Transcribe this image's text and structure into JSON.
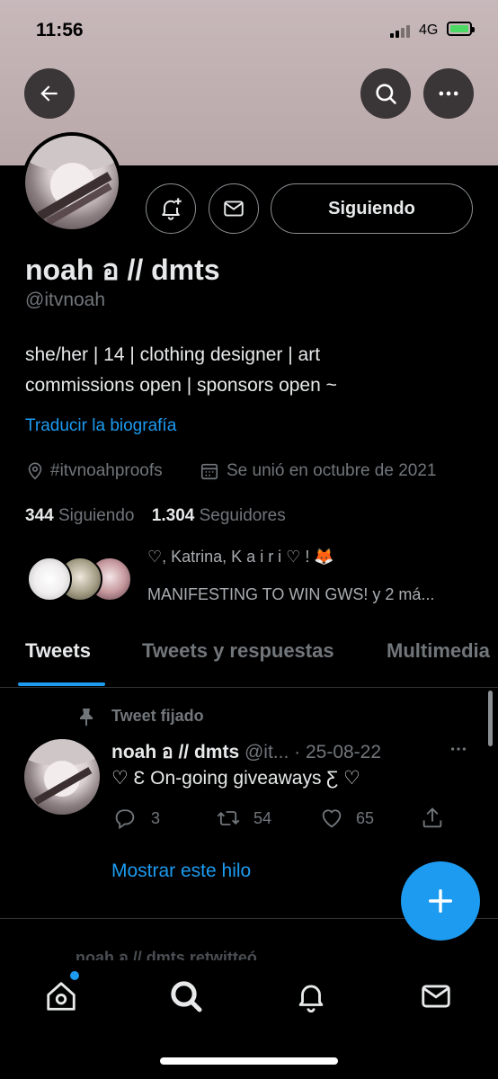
{
  "status_bar": {
    "time": "11:56",
    "network": "4G"
  },
  "header": {
    "back_icon": "arrow-left-icon",
    "search_icon": "search-icon",
    "more_icon": "more-icon"
  },
  "profile": {
    "name": "noah อ // dmts",
    "handle": "@itvnoah",
    "bio_line1": "she/her | 14 | clothing designer | art",
    "bio_line2": "commissions open | sponsors open ~",
    "translate_label": "Traducir la biografía",
    "location": "#itvnoahproofs",
    "joined": "Se unió en octubre de 2021",
    "following_count": "344",
    "following_label": "Siguiendo",
    "followers_count": "1.304",
    "followers_label": "Seguidores",
    "followed_by_line1": "♡, Katrina, K a i r i ♡ ! 🦊",
    "followed_by_line2": "MANIFESTING TO WIN GWS! y 2 má..."
  },
  "actions": {
    "following_button": "Siguiendo"
  },
  "tabs": [
    {
      "label": "Tweets"
    },
    {
      "label": "Tweets y respuestas"
    },
    {
      "label": "Multimedia"
    }
  ],
  "tweet": {
    "pinned_label": "Tweet fijado",
    "author_name": "noah อ // dmts",
    "author_handle": "@it...",
    "date": "· 25-08-22",
    "text": "♡ Ԑ On-going giveaways Ƹ ♡",
    "replies": "3",
    "retweets": "54",
    "likes": "65",
    "show_thread": "Mostrar este hilo"
  },
  "next_item": {
    "text": "noah อ // dmts retwitteó"
  },
  "colors": {
    "accent": "#1d9bf0",
    "background": "#000000",
    "banner": "#c1b1b3",
    "muted": "#71767b"
  }
}
